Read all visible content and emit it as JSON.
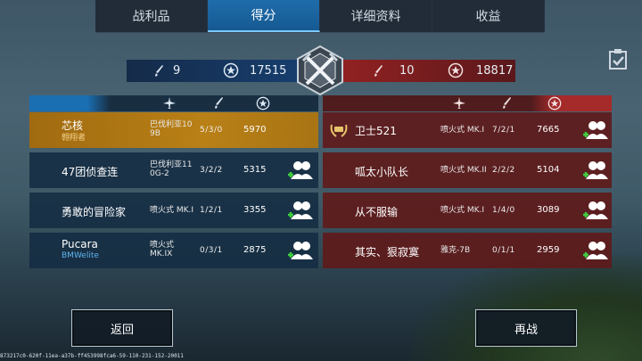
{
  "tabs": [
    {
      "label": "战利品",
      "active": false
    },
    {
      "label": "得分",
      "active": true
    },
    {
      "label": "详细资料",
      "active": false
    },
    {
      "label": "收益",
      "active": false
    }
  ],
  "blue_team": {
    "kills": "9",
    "score": "17515",
    "color": "#1a6fb3"
  },
  "red_team": {
    "kills": "10",
    "score": "18817",
    "color": "#a52a2a"
  },
  "blue_rows": [
    {
      "name": "芯核",
      "subtitle": "翱翔者",
      "plane": "巴伐利亚10\n9B",
      "kda": "5/3/0",
      "points": "5970",
      "is_player": true
    },
    {
      "name": "47团侦查连",
      "subtitle": "",
      "plane": "巴伐利亚11\n0G-2",
      "kda": "3/2/2",
      "points": "5315",
      "is_player": false
    },
    {
      "name": "勇敢的冒险家",
      "subtitle": "",
      "plane": "喷火式 MK.I",
      "kda": "1/2/1",
      "points": "3355",
      "is_player": false
    },
    {
      "name": "Pucara",
      "subtitle": "BMWelite",
      "plane": "喷火式\nMK.IX",
      "kda": "0/3/1",
      "points": "2875",
      "is_player": false
    }
  ],
  "red_rows": [
    {
      "name": "卫士521",
      "plane": "喷火式 MK.I",
      "kda": "7/2/1",
      "points": "7665",
      "has_medal": true
    },
    {
      "name": "呱太小队长",
      "plane": "喷火式 MK.II",
      "kda": "2/2/2",
      "points": "5104",
      "has_medal": false
    },
    {
      "name": "从不服输",
      "plane": "喷火式 MK.I",
      "kda": "1/4/0",
      "points": "3089",
      "has_medal": false
    },
    {
      "name": "其实、狠寂寞",
      "plane": "雅克-7B",
      "kda": "0/1/1",
      "points": "2959",
      "has_medal": false
    }
  ],
  "buttons": {
    "back": "返回",
    "rematch": "再战"
  },
  "footer_id": "873217c0-620f-11ea-a37b-ff453998fca6-59-110-231-152-20011",
  "icons": [
    "clipboard-icon",
    "plane-icon",
    "sword-icon",
    "star-badge-icon",
    "add-friend-icon",
    "laurel-medal-icon",
    "crossed-swords-emblem-icon"
  ]
}
